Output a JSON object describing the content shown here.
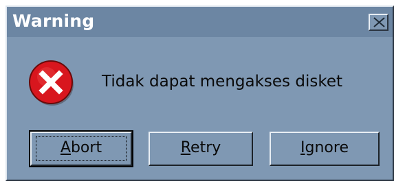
{
  "dialog": {
    "title": "Warning",
    "message": "Tidak dapat mengakses disket",
    "icon": "error-icon",
    "colors": {
      "titlebar": "#6c86a3",
      "body": "#7f98b3",
      "error_red": "#d8161e"
    }
  },
  "buttons": {
    "abort": {
      "mnemonic": "A",
      "rest": "bort"
    },
    "retry": {
      "mnemonic": "R",
      "rest": "etry"
    },
    "ignore": {
      "mnemonic": "I",
      "rest": "gnore"
    }
  }
}
